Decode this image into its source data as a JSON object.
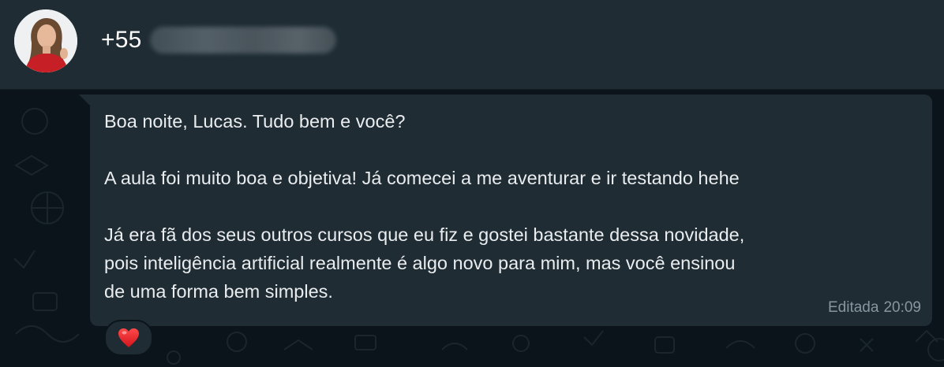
{
  "header": {
    "contact_prefix": "+55"
  },
  "message": {
    "lines": [
      "Boa noite, Lucas. Tudo bem e você?",
      "A aula foi muito boa e objetiva! Já comecei a me aventurar e ir testando hehe",
      "Já era fã dos seus outros cursos que eu fiz e gostei bastante dessa novidade,",
      "pois inteligência artificial realmente é algo novo para mim, mas você ensinou",
      "de uma forma bem simples."
    ],
    "edited_label": "Editada",
    "time": "20:09"
  },
  "reaction": {
    "emoji": "heart"
  },
  "colors": {
    "header_bg": "#1f2c33",
    "chat_bg": "#0b141a",
    "bubble_bg": "#202c33",
    "text": "#e9edef",
    "meta_text": "#8696a0"
  }
}
